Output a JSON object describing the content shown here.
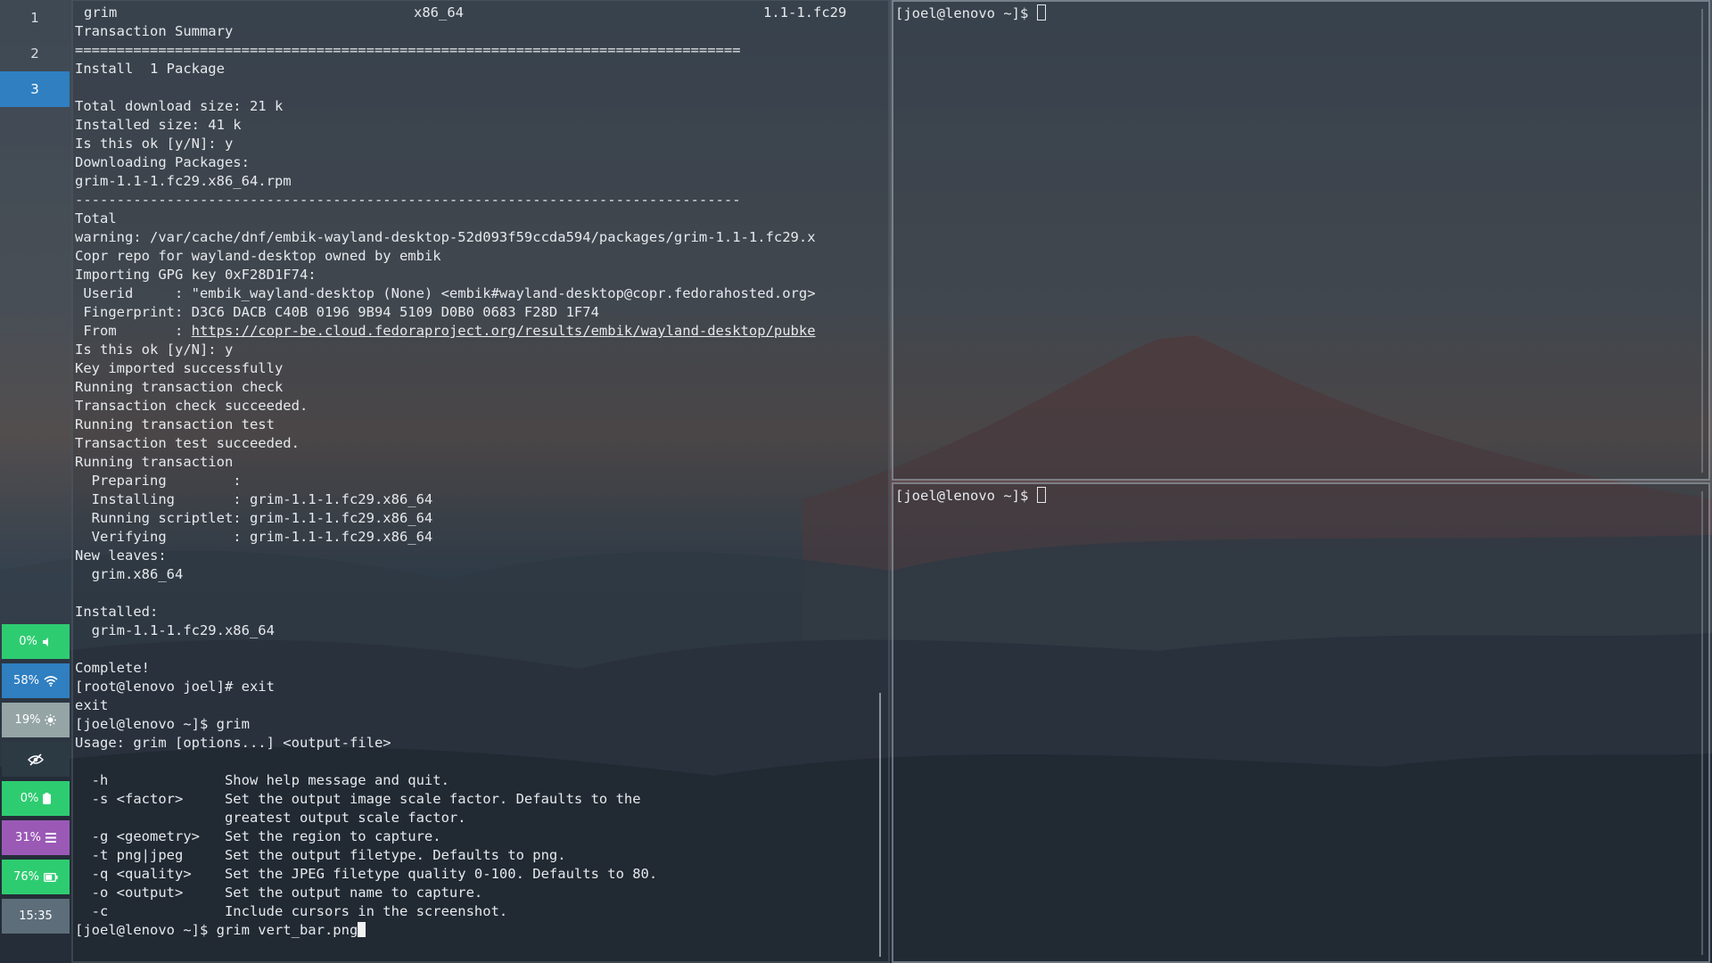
{
  "sidebar": {
    "workspaces": [
      {
        "label": "1",
        "active": false
      },
      {
        "label": "2",
        "active": false
      },
      {
        "label": "3",
        "active": true
      }
    ],
    "status": [
      {
        "value": "0%",
        "icon": "volume-icon",
        "color": "#2ecc71"
      },
      {
        "value": "58%",
        "icon": "wifi-icon",
        "color": "#2f7fc1"
      },
      {
        "value": "19%",
        "icon": "brightness-icon",
        "color": "#95a5a6"
      },
      {
        "value": "",
        "icon": "eye-off-icon",
        "color": "#2c3a44"
      },
      {
        "value": "0%",
        "icon": "battery-icon",
        "color": "#2ecc71"
      },
      {
        "value": "31%",
        "icon": "memory-icon",
        "color": "#9b59b6"
      },
      {
        "value": "76%",
        "icon": "battery-icon",
        "color": "#2ecc71"
      },
      {
        "value": "15:35",
        "icon": "",
        "color": "#5d6d7a"
      }
    ]
  },
  "terminal_left": {
    "header": {
      "name": "grim",
      "arch": "x86_64",
      "version": "1.1-1.fc29"
    },
    "lines": [
      "",
      "Transaction Summary",
      "================================================================================",
      "Install  1 Package",
      "",
      "Total download size: 21 k",
      "Installed size: 41 k",
      "Is this ok [y/N]: y",
      "Downloading Packages:",
      "grim-1.1-1.fc29.x86_64.rpm",
      "--------------------------------------------------------------------------------",
      "Total",
      "warning: /var/cache/dnf/embik-wayland-desktop-52d093f59ccda594/packages/grim-1.1-1.fc29.x",
      "Copr repo for wayland-desktop owned by embik",
      "Importing GPG key 0xF28D1F74:",
      " Userid     : \"embik_wayland-desktop (None) <embik#wayland-desktop@copr.fedorahosted.org>",
      " Fingerprint: D3C6 DACB C40B 0196 9B94 5109 D0B0 0683 F28D 1F74",
      " From       : ",
      "Is this ok [y/N]: y",
      "Key imported successfully",
      "Running transaction check",
      "Transaction check succeeded.",
      "Running transaction test",
      "Transaction test succeeded.",
      "Running transaction",
      "  Preparing        :",
      "  Installing       : grim-1.1-1.fc29.x86_64",
      "  Running scriptlet: grim-1.1-1.fc29.x86_64",
      "  Verifying        : grim-1.1-1.fc29.x86_64",
      "New leaves:",
      "  grim.x86_64",
      "",
      "Installed:",
      "  grim-1.1-1.fc29.x86_64",
      "",
      "Complete!",
      "[root@lenovo joel]# exit",
      "exit",
      "[joel@lenovo ~]$ grim",
      "Usage: grim [options...] <output-file>",
      "",
      "  -h              Show help message and quit.",
      "  -s <factor>     Set the output image scale factor. Defaults to the",
      "                  greatest output scale factor.",
      "  -g <geometry>   Set the region to capture.",
      "  -t png|jpeg     Set the output filetype. Defaults to png.",
      "  -q <quality>    Set the JPEG filetype quality 0-100. Defaults to 80.",
      "  -o <output>     Set the output name to capture.",
      "  -c              Include cursors in the screenshot.",
      "[joel@lenovo ~]$ grim vert_bar.png"
    ],
    "url": "https://copr-be.cloud.fedoraproject.org/results/embik/wayland-desktop/pubke"
  },
  "terminal_top_right": {
    "prompt": "[joel@lenovo ~]$ "
  },
  "terminal_bottom_right": {
    "prompt": "[joel@lenovo ~]$ "
  }
}
